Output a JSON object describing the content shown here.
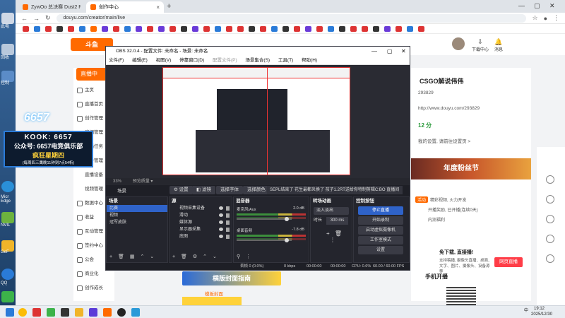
{
  "browser": {
    "tabs": [
      {
        "label": "ZywOo 总决赛 Dust2 POV Vi..."
      },
      {
        "label": "创作中心"
      }
    ],
    "url": "douyu.com/creator/main/live"
  },
  "desktop": {
    "labels": [
      "此电",
      "回收",
      "控制",
      "Micr Edge",
      "NVIL",
      "GeF",
      "QQ",
      "Wec"
    ]
  },
  "overlay": {
    "logo": "6657",
    "line1": "KOOK: 6657",
    "line2": "公众号: 6657电竞俱乐部",
    "line3": "疯狂星期四",
    "line4": "(每周四三鹰晚11钟到7点54析)"
  },
  "douyu": {
    "top_right": {
      "download": "下载中心",
      "messages": "消息"
    },
    "live_button": "直播中",
    "sidebar": [
      "主页",
      "直播首页",
      "创作管理",
      "房间管理",
      "主播任务",
      "综合管理",
      "直播设备",
      "视频管理",
      "数据中心",
      "收益",
      "互动管理",
      "签约中心",
      "公会",
      "商业化",
      "创作成长"
    ],
    "streamer_name": "CSGO解说伟伟",
    "room_id": "293829",
    "room_url": "http://www.douyu.com/293829",
    "level": "12 分",
    "settings_tip": "我的设置, 请前往设置页 >",
    "banner": "年度粉丝节",
    "promo_tag": "活动",
    "promo1": "精彩视频, 火力开发",
    "promo2": "开播奖励, 已开播(连续0天)",
    "promo3": "内测福利",
    "exempt_title": "免下载, 直接播!",
    "exempt_text": "支持稿播, 摄像头直播、桌面、文字、图片、摄像头、设备源等",
    "open_live": "网页直播",
    "phone_title": "手机开播",
    "poster_text": "横版封面指南",
    "template_label": "模板封面"
  },
  "obs": {
    "title": "OBS 32.0.4 - 配置文件: 未命名 - 场景: 未命名",
    "menu": [
      "文件(F)",
      "编辑(E)",
      "视图(V)",
      "停靠窗口(D)",
      "配置文件(P)",
      "场景集合(S)",
      "工具(T)",
      "帮助(H)"
    ],
    "zoom": "33%",
    "preview_label": "预览质量 ▾",
    "scene_label": "场景",
    "buttons": [
      "设置",
      "滤镜",
      "选择字体",
      "选择颜色"
    ],
    "ticker": "SEPL结束了 花生最都炎换了 孩子1.2RT送给你特制剪辑C:BO 直播间",
    "panels": {
      "scenes": "场景",
      "sources": "源",
      "mixer": "混音器",
      "transitions": "转场动画",
      "controls": "控制按钮"
    },
    "scenes": [
      "比赛",
      "视频",
      "冠军皮肤"
    ],
    "sources": [
      "视频采集设备",
      "滑动",
      "媒体源",
      "显示器采集",
      "底图"
    ],
    "mixer": [
      {
        "name": "麦克风/Aux",
        "db": "2.0 dB"
      },
      {
        "name": "桌面音频",
        "db": "-7.8 dB"
      }
    ],
    "transition": "淡入淡出",
    "duration_label": "时长",
    "duration": "300 ms",
    "controls": [
      "停止直播",
      "开始录制",
      "启动虚拟摄像机",
      "工作室模式",
      "设置"
    ],
    "status": {
      "frames": "丢帧 0 (0.0%)",
      "kbps": "0 kbps",
      "rec": "00:00:00",
      "live": "00:00:00",
      "cpu": "CPU: 0.6%",
      "fps": "60.00 / 60.00 FPS"
    }
  },
  "taskbar": {
    "lang": "中",
    "time": "19:12",
    "date": "2025/12/30"
  }
}
